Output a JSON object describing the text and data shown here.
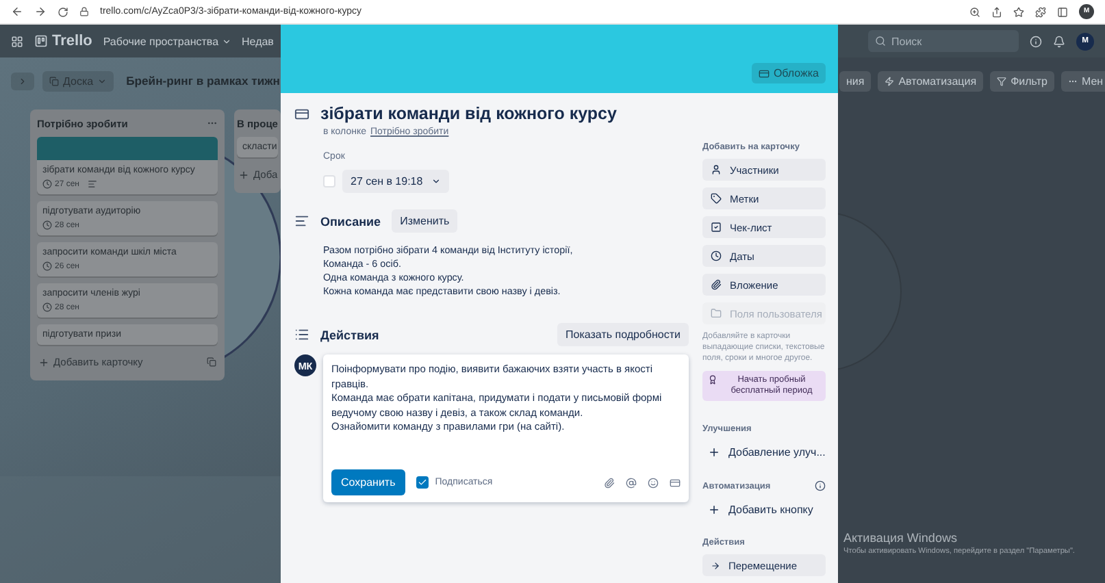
{
  "browser": {
    "url": "trello.com/c/AyZca0P3/3-зібрати-команди-від-кожного-курсу",
    "avatar": "M"
  },
  "header": {
    "logo": "Trello",
    "menus": [
      "Рабочие пространства",
      "Недав"
    ],
    "search": {
      "placeholder": "Поиск"
    },
    "avatar": "M"
  },
  "board_bar": {
    "view": "Доска",
    "title": "Брейн-ринг в рамках тижн",
    "buttons": [
      {
        "label": "ния",
        "kind": "plain"
      },
      {
        "label": "Автоматизация",
        "kind": "automation"
      },
      {
        "label": "Фильтр",
        "kind": "filter"
      },
      {
        "label": "Мен",
        "kind": "menu"
      }
    ]
  },
  "lists": [
    {
      "title": "Потрібно зробити",
      "cards": [
        {
          "cover": true,
          "title": "зібрати команди від кожного курсу",
          "date": "27 сен",
          "has_description": true
        },
        {
          "cover": false,
          "title": "підготувати аудиторію",
          "date": "28 сен",
          "has_description": false
        },
        {
          "cover": false,
          "title": "запросити команди шкіл міста",
          "date": "26 сен",
          "has_description": false
        },
        {
          "cover": false,
          "title": "запросити членів журі",
          "date": "28 сен",
          "has_description": false
        },
        {
          "cover": false,
          "title": "підготувати призи",
          "has_description": false
        }
      ],
      "add": "Добавить карточку"
    },
    {
      "title": "В проце",
      "cards": [
        {
          "cover": false,
          "title": "скласти",
          "has_description": false
        }
      ],
      "add": "Доба"
    }
  ],
  "card_modal": {
    "cover_button": "Обложка",
    "title": "зібрати команди від кожного курсу",
    "in_list_prefix": "в колонке",
    "in_list": "Потрібно зробити",
    "due": {
      "label": "Срок",
      "value": "27 сен в 19:18",
      "checked": false
    },
    "description": {
      "heading": "Описание",
      "edit": "Изменить",
      "lines": [
        "Разом потрібно зібрати 4 команди від Інституту історії,",
        "Команда - 6 осіб.",
        "Одна команда з кожного курсу.",
        "Кожна команда має представити свою назву і девіз."
      ]
    },
    "activity": {
      "heading": "Действия",
      "details_button": "Показать подробности",
      "avatar": "МК",
      "comment_lines": [
        "Поінформувати про подію, виявити бажаючих взяти участь в якості гравців.",
        "Команда має обрати капітана, придумати і подати у письмовій формі ведучому свою назву і девіз, а також склад команди.",
        "Ознайомити команду з правилами гри (на сайті)."
      ],
      "save": "Сохранить",
      "subscribe": {
        "label": "Подписаться",
        "checked": true
      }
    },
    "sidebar": {
      "add_heading": "Добавить на карточку",
      "add_buttons": [
        {
          "label": "Участники",
          "kind": "members",
          "disabled": false
        },
        {
          "label": "Метки",
          "kind": "labels",
          "disabled": false
        },
        {
          "label": "Чек-лист",
          "kind": "checklist",
          "disabled": false
        },
        {
          "label": "Даты",
          "kind": "dates",
          "disabled": false
        },
        {
          "label": "Вложение",
          "kind": "attachment",
          "disabled": false
        },
        {
          "label": "Поля пользователя",
          "kind": "fields",
          "disabled": true
        }
      ],
      "hint": "Добавляйте в карточки выпадающие списки, текстовые поля, сроки и многое другое.",
      "trial_button": "Начать пробный бесплатный период",
      "powerups_heading": "Улучшения",
      "powerups_button": "Добавление улуч...",
      "automation_heading": "Автоматизация",
      "automation_button": "Добавить кнопку",
      "actions_heading": "Действия",
      "actions_button": "Перемещение"
    }
  },
  "windows_notice": {
    "title": "Активация Windows",
    "text": "Чтобы активировать Windows, перейдите в раздел \"Параметры\"."
  }
}
